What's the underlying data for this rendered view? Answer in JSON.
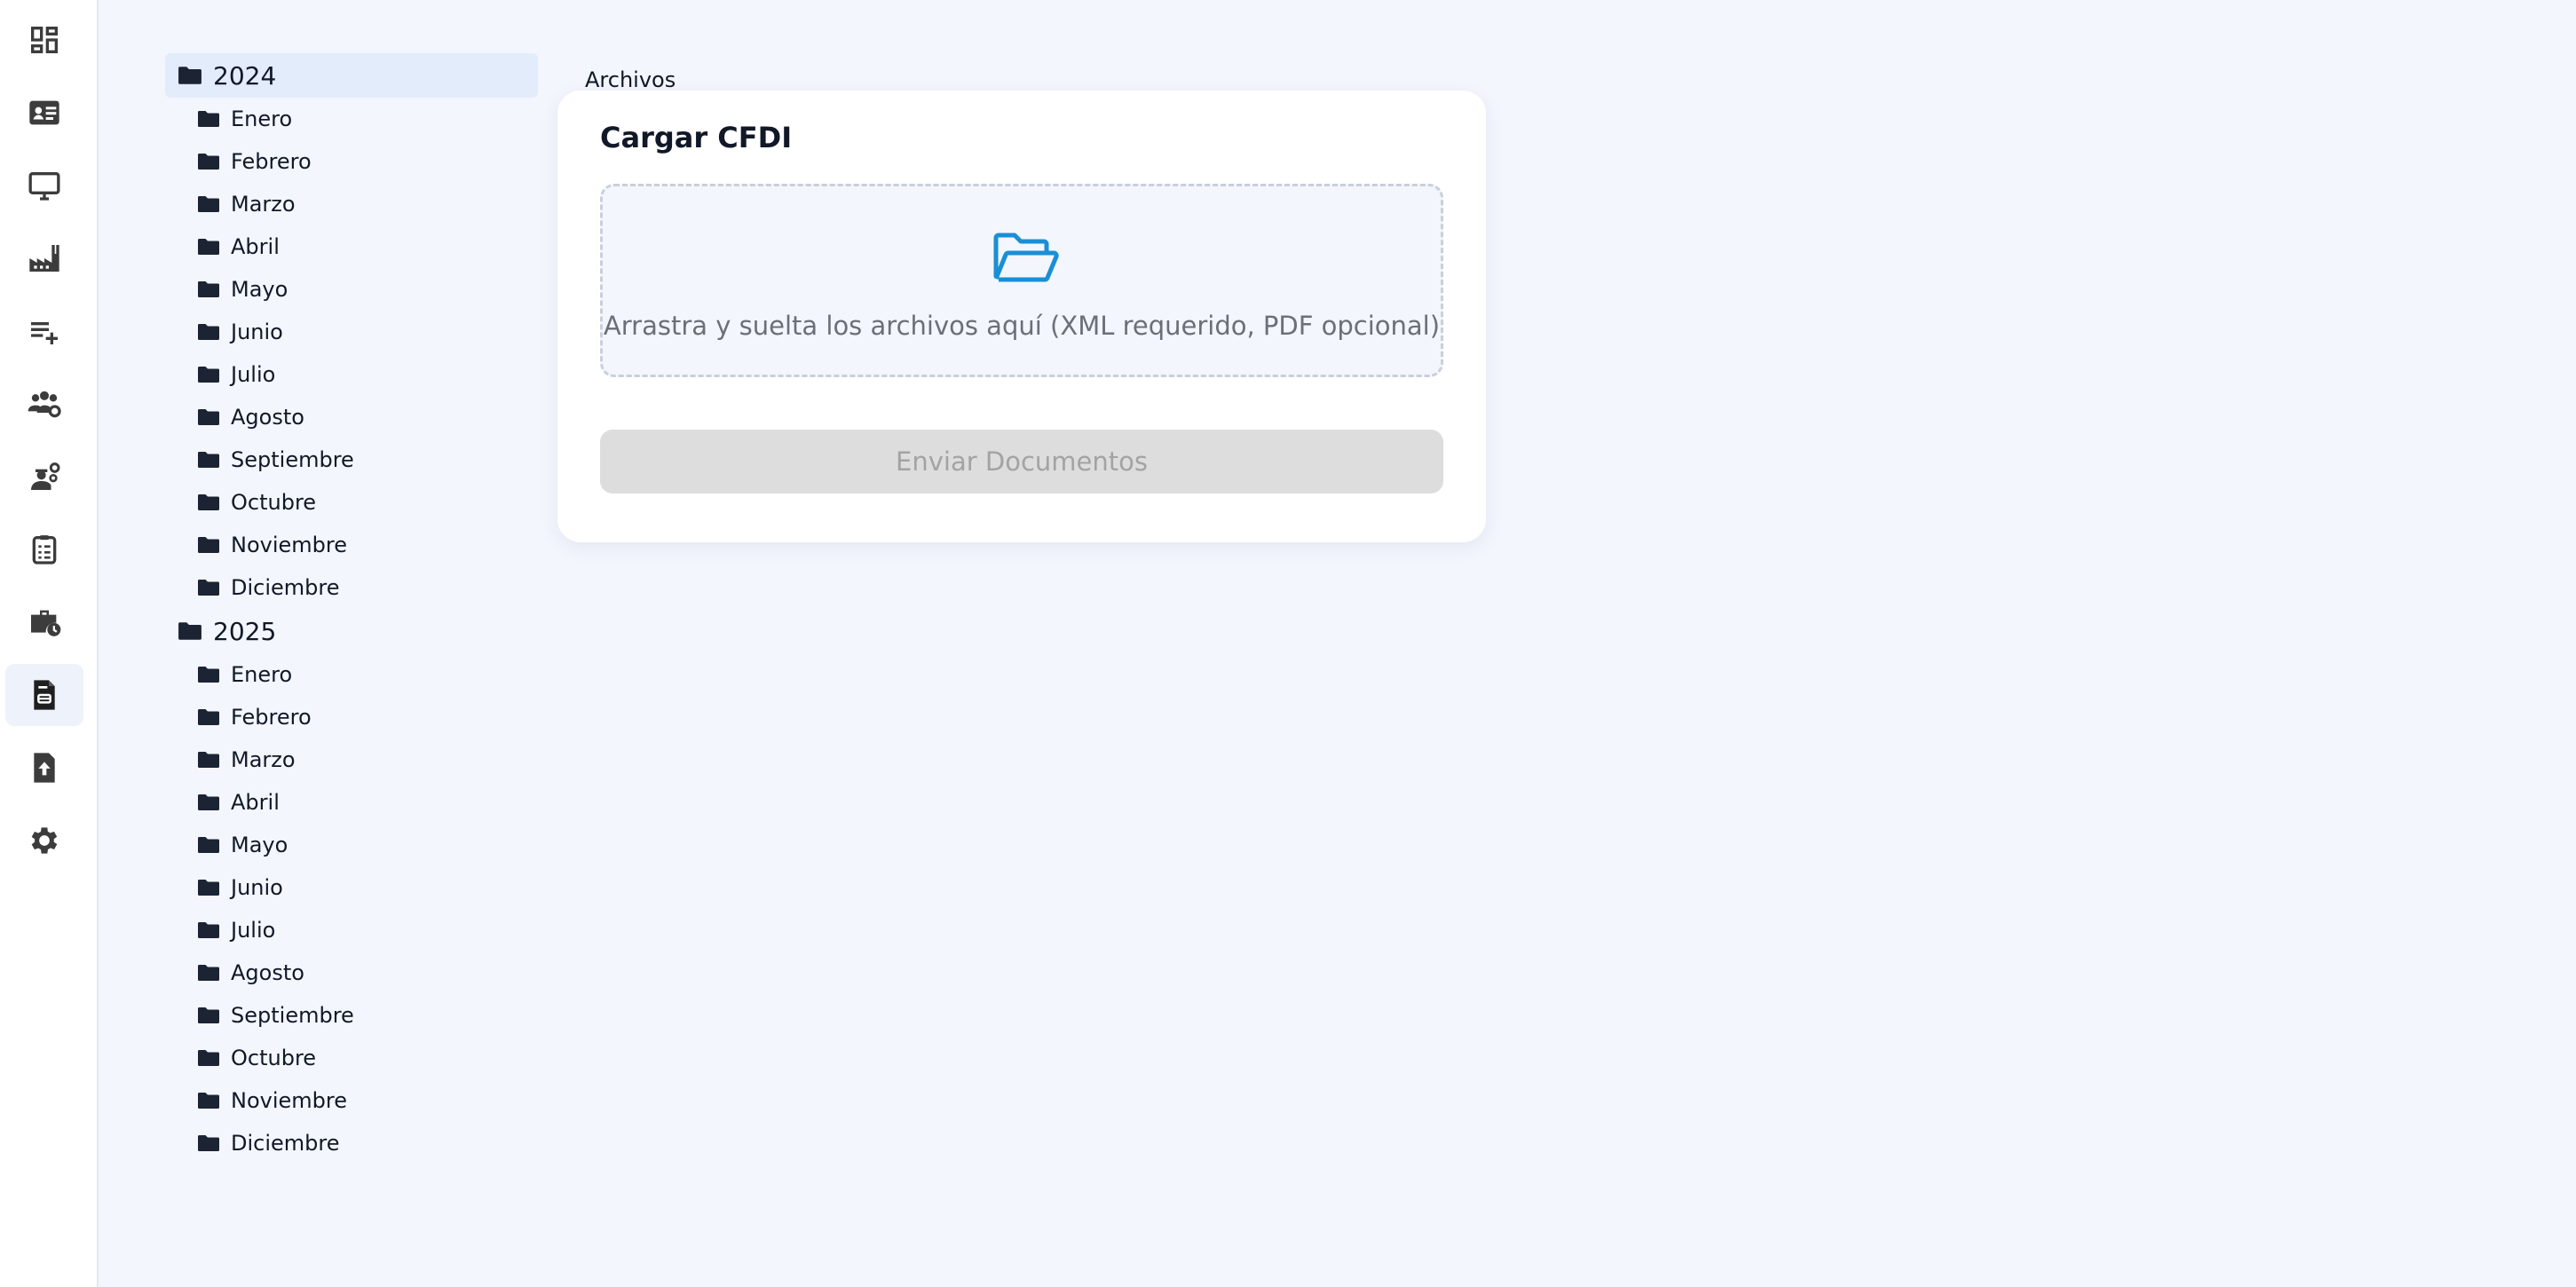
{
  "sidebar": {
    "items": [
      {
        "icon": "dashboard-icon"
      },
      {
        "icon": "id-card-icon"
      },
      {
        "icon": "monitor-icon"
      },
      {
        "icon": "factory-icon"
      },
      {
        "icon": "playlist-add-icon"
      },
      {
        "icon": "users-settings-icon"
      },
      {
        "icon": "worker-settings-icon"
      },
      {
        "icon": "clipboard-list-icon"
      },
      {
        "icon": "briefcase-clock-icon"
      },
      {
        "icon": "invoice-document-icon",
        "active": true
      },
      {
        "icon": "file-upload-icon"
      },
      {
        "icon": "gear-icon"
      }
    ]
  },
  "tree": {
    "years": [
      {
        "label": "2024",
        "selected": true,
        "months": [
          "Enero",
          "Febrero",
          "Marzo",
          "Abril",
          "Mayo",
          "Junio",
          "Julio",
          "Agosto",
          "Septiembre",
          "Octubre",
          "Noviembre",
          "Diciembre"
        ]
      },
      {
        "label": "2025",
        "selected": false,
        "months": [
          "Enero",
          "Febrero",
          "Marzo",
          "Abril",
          "Mayo",
          "Junio",
          "Julio",
          "Agosto",
          "Septiembre",
          "Octubre",
          "Noviembre",
          "Diciembre"
        ]
      }
    ]
  },
  "main": {
    "section_label": "Archivos",
    "card": {
      "title": "Cargar CFDI",
      "dropzone_text": "Arrastra y suelta los archivos aquí (XML requerido, PDF opcional)",
      "submit_label": "Enviar Documentos"
    }
  },
  "colors": {
    "accent": "#1a8fd6",
    "icon": "#3c3c3c",
    "folder": "#1c2433",
    "disabled_bg": "#dddddd",
    "disabled_text": "#a3a3a3",
    "selected_row": "#e3ecfa"
  }
}
